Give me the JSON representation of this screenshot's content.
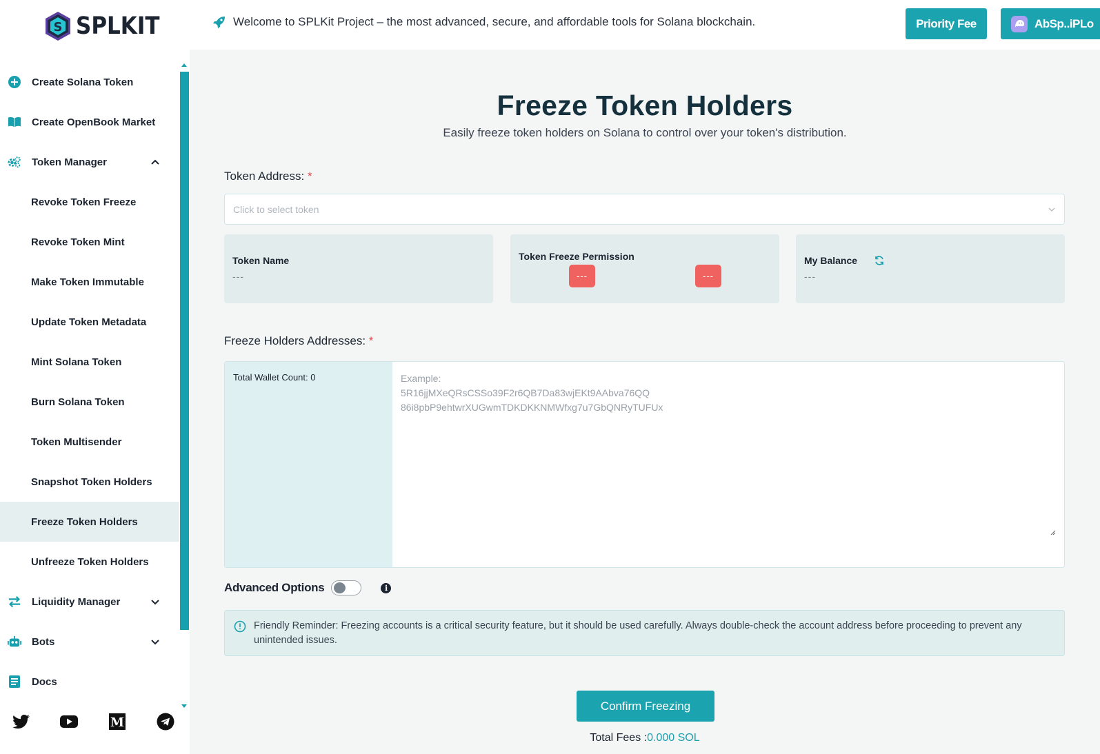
{
  "header": {
    "logo_text": "SPLKIT",
    "welcome": "Welcome to SPLKit Project – the most advanced, secure, and affordable tools for Solana blockchain.",
    "priority_fee_label": "Priority Fee",
    "wallet_label": "AbSp..iPLo"
  },
  "sidebar": {
    "items": [
      {
        "label": "Create Solana Token",
        "icon": "plus-circle-icon"
      },
      {
        "label": "Create OpenBook Market",
        "icon": "book-open-icon"
      },
      {
        "label": "Token Manager",
        "icon": "gears-icon",
        "expanded": true
      },
      {
        "label": "Revoke Token Freeze"
      },
      {
        "label": "Revoke Token Mint"
      },
      {
        "label": "Make Token Immutable"
      },
      {
        "label": "Update Token Metadata"
      },
      {
        "label": "Mint Solana Token"
      },
      {
        "label": "Burn Solana Token"
      },
      {
        "label": "Token Multisender"
      },
      {
        "label": "Snapshot Token Holders"
      },
      {
        "label": "Freeze Token Holders",
        "active": true
      },
      {
        "label": "Unfreeze Token Holders"
      },
      {
        "label": "Liquidity Manager",
        "icon": "swap-arrows-icon",
        "expanded": false
      },
      {
        "label": "Bots",
        "icon": "robot-icon",
        "expanded": false
      },
      {
        "label": "Docs",
        "icon": "document-icon"
      }
    ],
    "socials": [
      "twitter-icon",
      "youtube-icon",
      "medium-icon",
      "telegram-icon"
    ]
  },
  "main": {
    "title": "Freeze Token Holders",
    "subtitle": "Easily freeze token holders on Solana to control over your token's distribution.",
    "token_address_label": "Token Address:",
    "required_mark": "*",
    "token_select_placeholder": "Click to select token",
    "cards": {
      "token_name_title": "Token Name",
      "token_name_value": "---",
      "freeze_permission_title": "Token Freeze Permission",
      "freeze_permission_value_1": "---",
      "freeze_permission_value_2": "---",
      "balance_title": "My Balance",
      "balance_value": "---"
    },
    "holders_label": "Freeze Holders Addresses:",
    "wallet_count": "Total Wallet Count: 0",
    "holders_placeholder": "Example:\n5R16jjMXeQRsCSSo39F2r6QB7Da83wjEKt9AAbva76QQ\n86i8pbP9ehtwrXUGwmTDKDKKNMWfxg7u7GbQNRyTUFUx",
    "advanced_options_label": "Advanced Options",
    "reminder": "Friendly Reminder: Freezing accounts is a critical security feature, but it should be used carefully. Always double-check the account address before proceeding to prevent any unintended issues.",
    "confirm_label": "Confirm Freezing",
    "total_fees_label": "Total Fees :",
    "total_fees_value": "0.000 SOL"
  },
  "colors": {
    "accent": "#1ba3b0",
    "danger": "#f0625f",
    "title": "#14303c"
  }
}
